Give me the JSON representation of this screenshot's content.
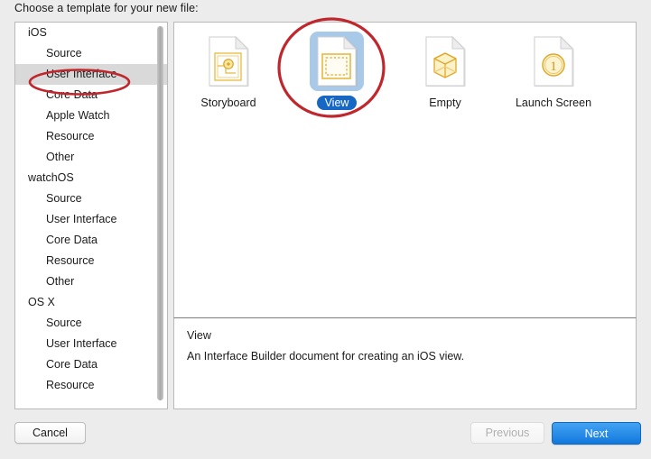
{
  "dialog": {
    "title": "Choose a template for your new file:"
  },
  "sidebar": {
    "groups": [
      {
        "label": "iOS",
        "items": [
          "Source",
          "User Interface",
          "Core Data",
          "Apple Watch",
          "Resource",
          "Other"
        ]
      },
      {
        "label": "watchOS",
        "items": [
          "Source",
          "User Interface",
          "Core Data",
          "Resource",
          "Other"
        ]
      },
      {
        "label": "OS X",
        "items": [
          "Source",
          "User Interface",
          "Core Data",
          "Resource"
        ]
      }
    ],
    "selected": "User Interface",
    "scrollbar": "vertical-scrollbar"
  },
  "templates": [
    {
      "label": "Storyboard",
      "icon": "storyboard-icon",
      "selected": false
    },
    {
      "label": "View",
      "icon": "view-icon",
      "selected": true
    },
    {
      "label": "Empty",
      "icon": "empty-icon",
      "selected": false
    },
    {
      "label": "Launch Screen",
      "icon": "launch-screen-icon",
      "selected": false
    }
  ],
  "description": {
    "title": "View",
    "body": "An Interface Builder document for creating an iOS view."
  },
  "buttons": {
    "cancel": "Cancel",
    "previous": "Previous",
    "next": "Next"
  },
  "annotations": {
    "sidebar_circle": "red-ellipse-annotation",
    "view_circle": "red-circle-annotation",
    "color": "#c0272d"
  },
  "colors": {
    "selection_blue": "#a9c9e8",
    "label_blue": "#1668c4",
    "next_blue": "#1178dd",
    "row_selected_grey": "#d9d9d9",
    "icon_gold": "#e8b940"
  }
}
